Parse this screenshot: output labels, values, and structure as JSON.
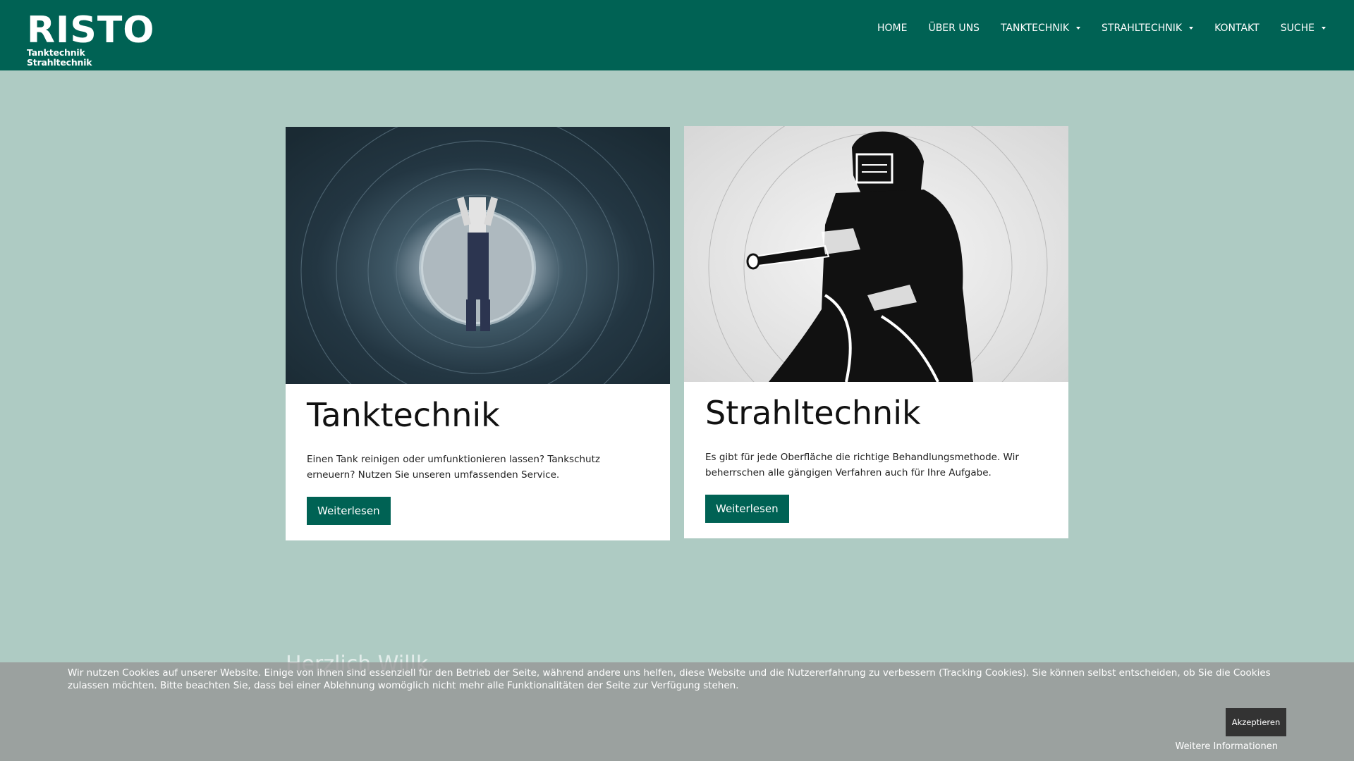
{
  "header": {
    "logo_main": "RISTO",
    "logo_sub": "Tanktechnik Strahltechnik",
    "nav": [
      {
        "label": "HOME"
      },
      {
        "label": "ÜBER UNS"
      },
      {
        "label": "TANKTECHNIK"
      },
      {
        "label": "STRAHLTECHNIK"
      },
      {
        "label": "KONTAKT"
      },
      {
        "label": "SUCHE"
      }
    ]
  },
  "cards": [
    {
      "title": "Tanktechnik",
      "text": "Einen Tank reinigen oder umfunktionieren lassen? Tankschutz erneuern? Nutzen Sie unseren umfassenden Service.",
      "button": "Weiterlesen"
    },
    {
      "title": "Strahltechnik",
      "text": "Es gibt für jede Oberfläche die richtige Behandlungsmethode. Wir beherrschen alle gängigen Verfahren auch für Ihre Aufgabe.",
      "button": "Weiterlesen"
    }
  ],
  "welcome_partial": "Herzlich Willk",
  "cookie": {
    "text": "Wir nutzen Cookies auf unserer Website. Einige von ihnen sind essenziell für den Betrieb der Seite, während andere uns helfen, diese Website und die Nutzererfahrung zu verbessern (Tracking Cookies). Sie können selbst entscheiden, ob Sie die Cookies zulassen möchten. Bitte beachten Sie, dass bei einer Ablehnung womöglich nicht mehr alle Funktionalitäten der Seite zur Verfügung stehen.",
    "accept_label": "Akzeptieren",
    "more_label": "Weitere Informationen"
  },
  "colors": {
    "brand": "#006254",
    "background": "#aecbc3"
  }
}
